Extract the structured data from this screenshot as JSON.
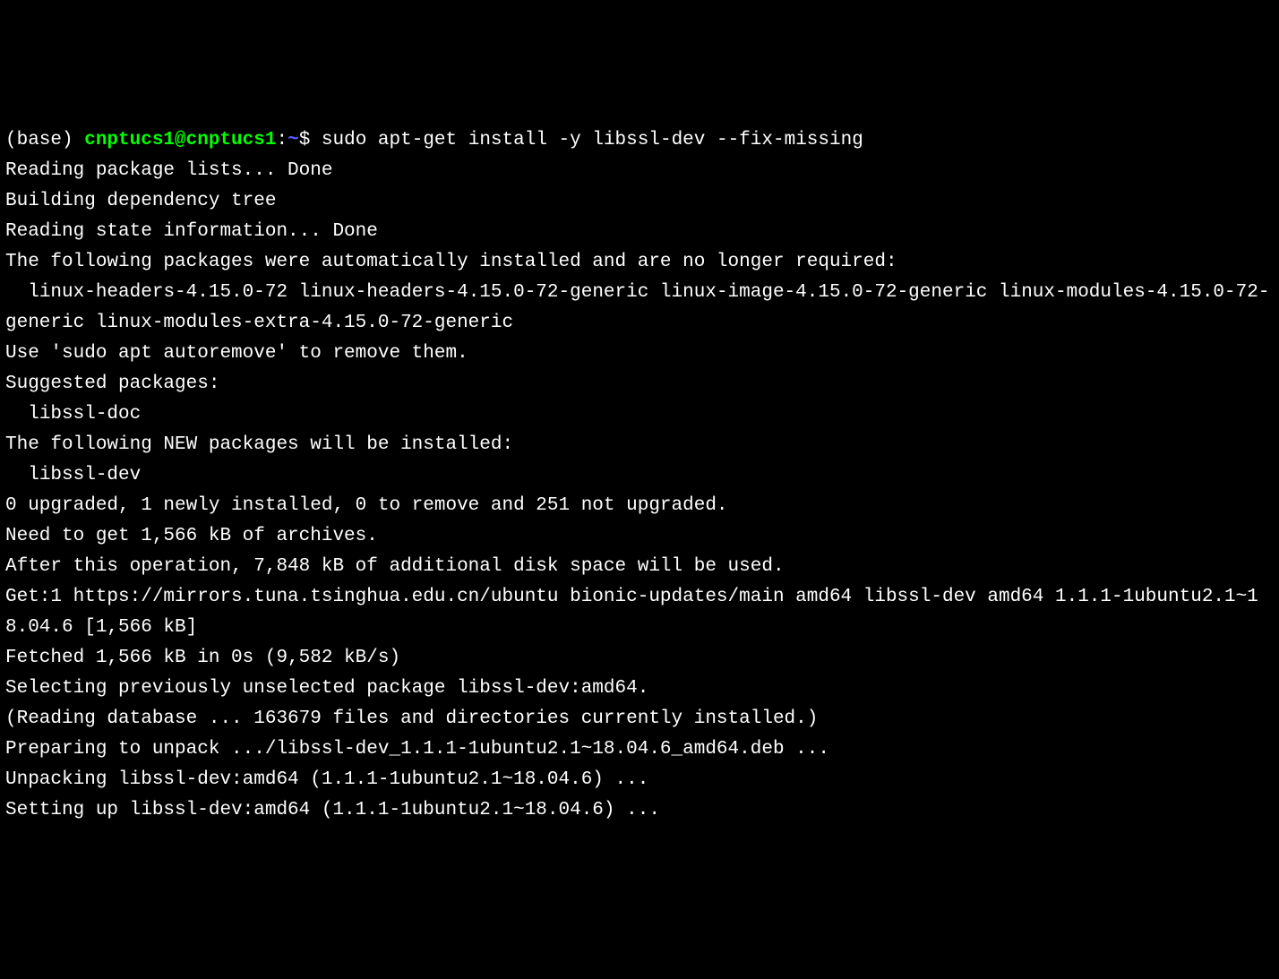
{
  "prompt": {
    "prefix": "(base) ",
    "user": "cnptucs1@cnptucs1",
    "colon": ":",
    "tilde": "~",
    "dollar": "$ "
  },
  "command": "sudo apt-get install -y libssl-dev --fix-missing",
  "output": {
    "l1": "Reading package lists... Done",
    "l2": "Building dependency tree",
    "l3": "Reading state information... Done",
    "l4": "The following packages were automatically installed and are no longer required:",
    "l5": "  linux-headers-4.15.0-72 linux-headers-4.15.0-72-generic linux-image-4.15.0-72-generic linux-modules-4.15.0-72-generic linux-modules-extra-4.15.0-72-generic",
    "l6": "Use 'sudo apt autoremove' to remove them.",
    "l7": "Suggested packages:",
    "l8": "  libssl-doc",
    "l9": "The following NEW packages will be installed:",
    "l10": "  libssl-dev",
    "l11": "0 upgraded, 1 newly installed, 0 to remove and 251 not upgraded.",
    "l12": "Need to get 1,566 kB of archives.",
    "l13": "After this operation, 7,848 kB of additional disk space will be used.",
    "l14": "Get:1 https://mirrors.tuna.tsinghua.edu.cn/ubuntu bionic-updates/main amd64 libssl-dev amd64 1.1.1-1ubuntu2.1~18.04.6 [1,566 kB]",
    "l15": "Fetched 1,566 kB in 0s (9,582 kB/s)",
    "l16": "Selecting previously unselected package libssl-dev:amd64.",
    "l17": "(Reading database ... 163679 files and directories currently installed.)",
    "l18": "Preparing to unpack .../libssl-dev_1.1.1-1ubuntu2.1~18.04.6_amd64.deb ...",
    "l19": "Unpacking libssl-dev:amd64 (1.1.1-1ubuntu2.1~18.04.6) ...",
    "l20": "Setting up libssl-dev:amd64 (1.1.1-1ubuntu2.1~18.04.6) ..."
  }
}
